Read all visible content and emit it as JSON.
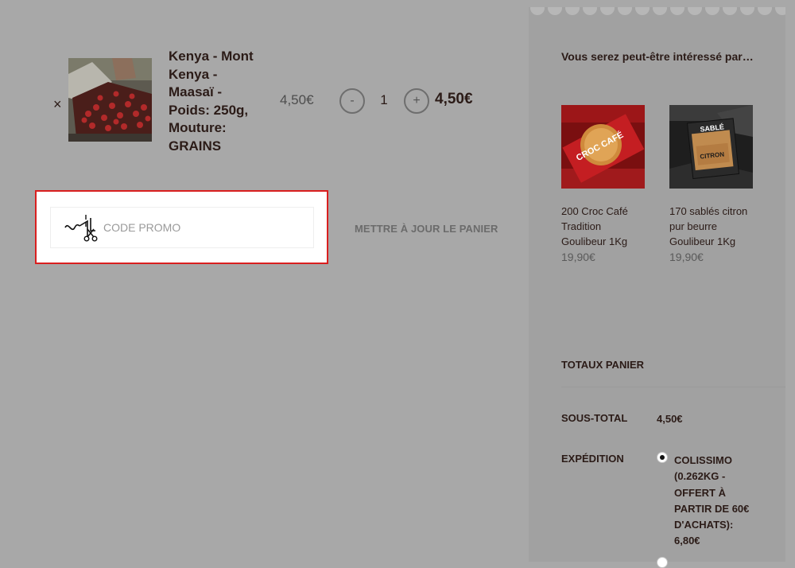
{
  "cart": {
    "remove_symbol": "×",
    "product_name": "Kenya - Mont Kenya - Maasaï - Poids: 250g, Mouture: GRAINS",
    "price": "4,50€",
    "qty_minus": "-",
    "quantity": "1",
    "qty_plus": "+",
    "line_total": "4,50€"
  },
  "coupon": {
    "placeholder": "CODE PROMO",
    "icon": "scissors-coupon-icon",
    "highlight_color": "#d91f1f"
  },
  "update_button": "METTRE À JOUR LE PANIER",
  "cross_sells": {
    "title": "Vous serez peut-être intéressé par…",
    "items": [
      {
        "name": "200 Croc Café Tradition Goulibeur 1Kg",
        "price": "19,90€",
        "image_text": "CROC CAFÉ"
      },
      {
        "name": "170 sablés citron pur beurre Goulibeur 1Kg",
        "price": "19,90€",
        "image_text_1": "SABLÉ",
        "image_text_2": "CITRON"
      }
    ]
  },
  "totals": {
    "title": "TOTAUX PANIER",
    "subtotal_label": "SOUS-TOTAL",
    "subtotal_value": "4,50€",
    "shipping_label": "EXPÉDITION",
    "shipping_option": "COLISSIMO (0.262KG - OFFERT À PARTIR DE 60€ D'ACHATS): 6,80€"
  }
}
